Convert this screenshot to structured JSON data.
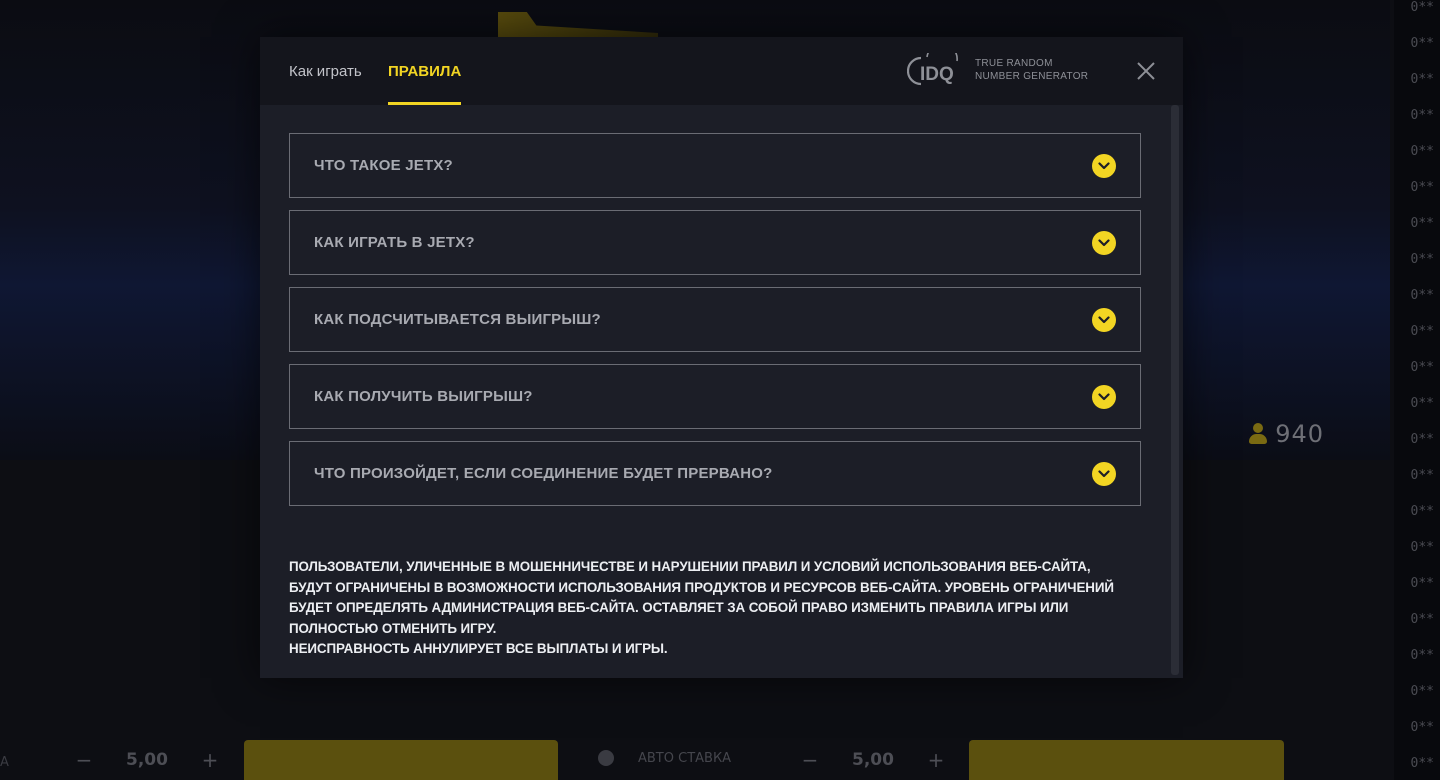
{
  "background": {
    "balance": "940",
    "multipliers": [
      "0**",
      "0**",
      "0**",
      "0**",
      "0**",
      "0**",
      "0**",
      "0**",
      "0**",
      "0**",
      "0**",
      "0**",
      "0**",
      "0**",
      "0**",
      "0**",
      "0**",
      "0**",
      "0**",
      "0**",
      "0**",
      "0**"
    ],
    "bet_left": {
      "minus": "−",
      "value": "5,00",
      "plus": "+"
    },
    "bet_right": {
      "minus": "−",
      "value": "5,00",
      "plus": "+"
    },
    "auto_bet_label": "АВТО СТАВКА",
    "left_edge_char": "A"
  },
  "modal": {
    "tabs": [
      {
        "label": "Как играть",
        "active": false
      },
      {
        "label": "ПРАВИЛА",
        "active": true
      }
    ],
    "rng_logo": {
      "mark": "IDQ",
      "line1": "TRUE RANDOM",
      "line2": "NUMBER GENERATOR"
    },
    "close_icon": "close-icon",
    "faq": [
      {
        "question": "ЧТО ТАКОЕ JETX?"
      },
      {
        "question": "КАК ИГРАТЬ В JETX?"
      },
      {
        "question": "КАК ПОДСЧИТЫВАЕТСЯ ВЫИГРЫШ?"
      },
      {
        "question": "КАК ПОЛУЧИТЬ ВЫИГРЫШ?"
      },
      {
        "question": "ЧТО ПРОИЗОЙДЕТ, ЕСЛИ СОЕДИНЕНИЕ БУДЕТ ПРЕРВАНО?"
      }
    ],
    "disclaimer_lines": [
      "ПОЛЬЗОВАТЕЛИ, УЛИЧЕННЫЕ В МОШЕННИЧЕСТВЕ И НАРУШЕНИИ ПРАВИЛ И УСЛОВИЙ ИСПОЛЬЗОВАНИЯ ВЕБ-САЙТА,",
      "БУДУТ ОГРАНИЧЕНЫ В ВОЗМОЖНОСТИ ИСПОЛЬЗОВАНИЯ ПРОДУКТОВ И РЕСУРСОВ ВЕБ-САЙТА. УРОВЕНЬ ОГРАНИЧЕНИЙ",
      "БУДЕТ ОПРЕДЕЛЯТЬ АДМИНИСТРАЦИЯ ВЕБ-САЙТА. ОСТАВЛЯЕТ ЗА СОБОЙ ПРАВО ИЗМЕНИТЬ ПРАВИЛА ИГРЫ ИЛИ",
      "ПОЛНОСТЬЮ ОТМЕНИТЬ ИГРУ.",
      "НЕИСПРАВНОСТЬ АННУЛИРУЕТ ВСЕ ВЫПЛАТЫ И ИГРЫ."
    ]
  },
  "colors": {
    "accent": "#f2d523",
    "modal_bg": "#1c1e27",
    "header_bg": "#14151c",
    "item_border": "#6a6c74"
  }
}
